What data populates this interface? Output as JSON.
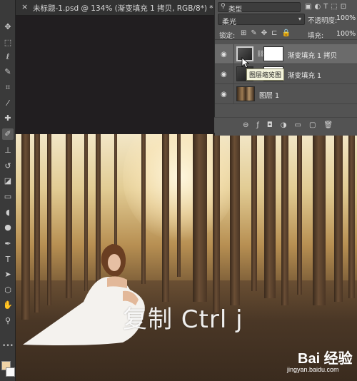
{
  "document": {
    "tab_title": "未标题-1.psd @ 134% (渐变填充 1 拷贝, RGB/8*) *",
    "close_glyph": "×"
  },
  "toolbar": {
    "tools": [
      {
        "name": "move-tool-icon",
        "glyph": "✥"
      },
      {
        "name": "marquee-tool-icon",
        "glyph": "⬚"
      },
      {
        "name": "lasso-tool-icon",
        "glyph": "ℓ"
      },
      {
        "name": "quick-select-tool-icon",
        "glyph": "✎"
      },
      {
        "name": "crop-tool-icon",
        "glyph": "⌗"
      },
      {
        "name": "eyedropper-tool-icon",
        "glyph": "⁄"
      },
      {
        "name": "healing-tool-icon",
        "glyph": "✚"
      },
      {
        "name": "brush-tool-icon",
        "glyph": "✐"
      },
      {
        "name": "stamp-tool-icon",
        "glyph": "⊥"
      },
      {
        "name": "history-brush-tool-icon",
        "glyph": "↺"
      },
      {
        "name": "eraser-tool-icon",
        "glyph": "◪"
      },
      {
        "name": "gradient-tool-icon",
        "glyph": "▭"
      },
      {
        "name": "blur-tool-icon",
        "glyph": "◖"
      },
      {
        "name": "dodge-tool-icon",
        "glyph": "●"
      },
      {
        "name": "pen-tool-icon",
        "glyph": "✒"
      },
      {
        "name": "type-tool-icon",
        "glyph": "T"
      },
      {
        "name": "path-select-tool-icon",
        "glyph": "➤"
      },
      {
        "name": "shape-tool-icon",
        "glyph": "⬡"
      },
      {
        "name": "hand-tool-icon",
        "glyph": "✋"
      },
      {
        "name": "zoom-tool-icon",
        "glyph": "⚲"
      }
    ],
    "more_glyph": "•••",
    "foreground_color": "#f0d3a5",
    "background_color": "#fafafa"
  },
  "layers_panel": {
    "filter_kind": "类型",
    "blend_mode": "柔光",
    "opacity_label": "不透明度:",
    "opacity_value": "100%",
    "lock_label": "锁定:",
    "fill_label": "填充:",
    "fill_value": "100%",
    "layers": [
      {
        "name": "渐变填充 1 拷贝",
        "selected": true
      },
      {
        "name": "渐变填充 1",
        "selected": false
      },
      {
        "name": "图层 1",
        "selected": false
      }
    ],
    "tooltip": "图层缩览图"
  },
  "canvas": {
    "overlay_text": "复制 Ctrl j",
    "watermark_brand": "Bai 经验",
    "watermark_url": "jingyan.baidu.com"
  }
}
